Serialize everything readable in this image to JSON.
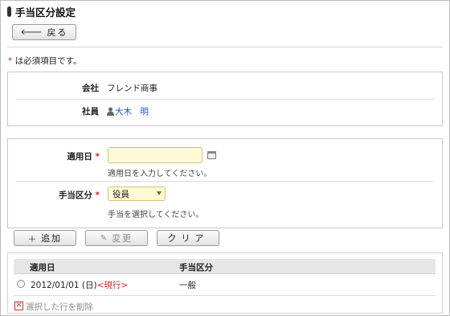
{
  "header": {
    "title": "手当区分設定",
    "back_label": "戻る",
    "back_icon": "arrow-left-icon"
  },
  "required_note": {
    "star": "*",
    "text": " は必須項目です。"
  },
  "info": {
    "company_label": "会社",
    "company_value": "フレンド商事",
    "employee_label": "社員",
    "employee_value": "大木　明"
  },
  "form": {
    "date_label": "適用日",
    "date_value": "",
    "date_hint": "適用日を入力してください。",
    "category_label": "手当区分",
    "category_selected": "役員",
    "category_hint": "手当を選択してください。",
    "required_star": "*"
  },
  "actions": {
    "add_label": "追加",
    "edit_label": "変更",
    "clear_label": "クリア"
  },
  "table": {
    "headers": [
      "適用日",
      "手当区分"
    ],
    "rows": [
      {
        "date": "2012/01/01 (日)",
        "status": "<現行>",
        "category": "一般"
      }
    ]
  },
  "delete_label": "選択した行を削除",
  "colors": {
    "required": "#dd2222",
    "link": "#1a55c9",
    "input_bg": "#fff9d6"
  }
}
